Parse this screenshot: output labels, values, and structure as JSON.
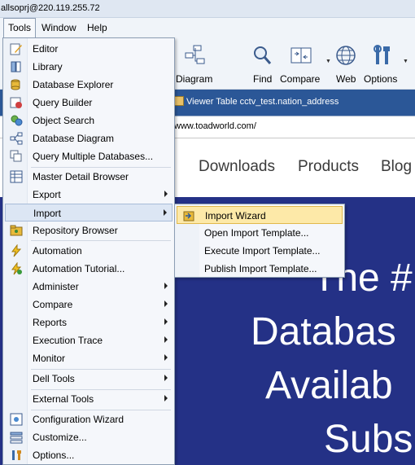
{
  "window": {
    "title": "allsoprj@220.119.255.72"
  },
  "menubar": {
    "tools": "Tools",
    "window": "Window",
    "help": "Help"
  },
  "toolbar": {
    "diagram": "Diagram",
    "find": "Find",
    "compare": "Compare",
    "web": "Web",
    "options": "Options"
  },
  "tab": {
    "title": "Viewer Table cctv_test.nation_address"
  },
  "address": {
    "url": "www.toadworld.com/"
  },
  "web": {
    "nav": [
      "Downloads",
      "Products",
      "Blog"
    ],
    "hero": [
      "The #",
      "Databas",
      "Availab",
      "Subs"
    ]
  },
  "tools_menu": {
    "items": [
      "Editor",
      "Library",
      "Database Explorer",
      "Query Builder",
      "Object Search",
      "Database Diagram",
      "Query Multiple Databases...",
      "Master Detail Browser",
      "Export",
      "Import",
      "Repository Browser",
      "Automation",
      "Automation Tutorial...",
      "Administer",
      "Compare",
      "Reports",
      "Execution Trace",
      "Monitor",
      "Dell Tools",
      "External Tools",
      "Configuration Wizard",
      "Customize...",
      "Options..."
    ]
  },
  "import_menu": {
    "items": [
      "Import Wizard",
      "Open Import Template...",
      "Execute Import Template...",
      "Publish Import Template..."
    ]
  },
  "colors": {
    "accent": "#2b5797",
    "hero": "#243186",
    "menu_highlight": "#fde9a8"
  }
}
